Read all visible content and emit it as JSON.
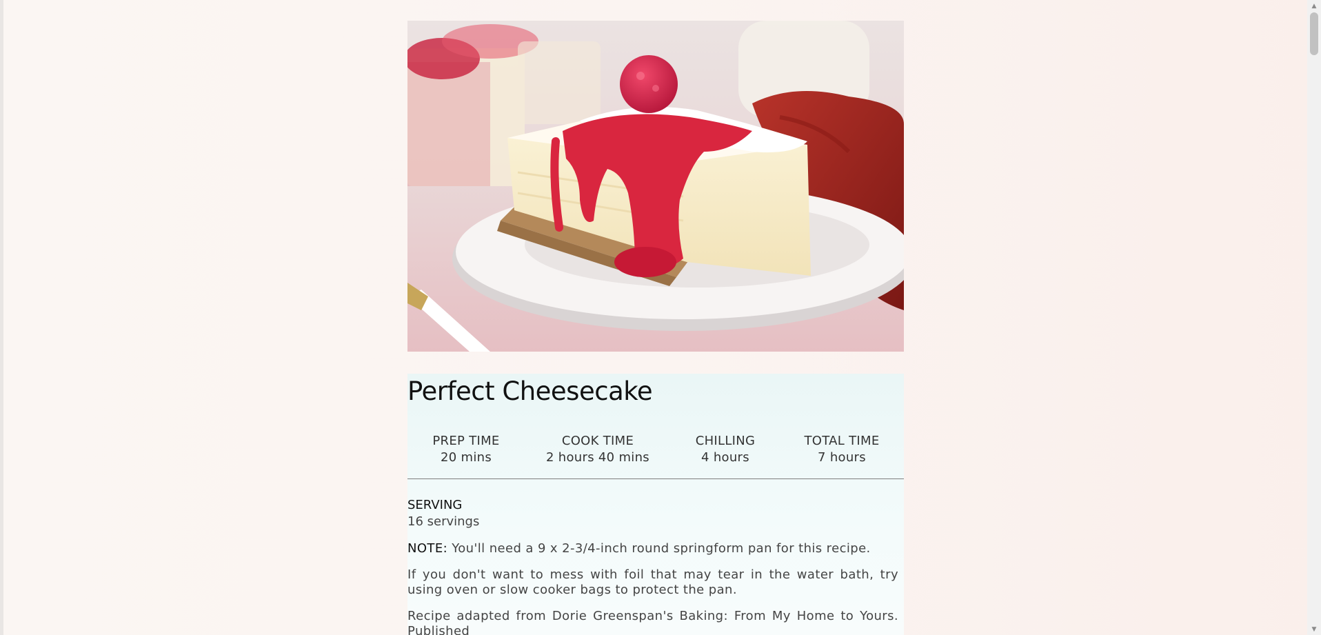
{
  "recipe": {
    "image_alt": "Slice of cheesecake topped with raspberry sauce and a raspberry",
    "title": "Perfect Cheesecake",
    "times": [
      {
        "label": "PREP TIME",
        "value": "20 mins"
      },
      {
        "label": "COOK TIME",
        "value": "2 hours 40 mins"
      },
      {
        "label": "CHILLING",
        "value": "4 hours"
      },
      {
        "label": "TOTAL TIME",
        "value": "7 hours"
      }
    ],
    "serving_label": "SERVING",
    "serving_value": "16 servings",
    "note_label": "NOTE:",
    "note_text": "You'll need a 9 x 2-3/4-inch round springform pan for this recipe.",
    "paragraph_1": "If you don't want to mess with foil that may tear in the water bath, try using oven or slow cooker bags to protect the pan.",
    "paragraph_2": "Recipe adapted from Dorie Greenspan's Baking: From My Home to Yours. Published"
  },
  "scrollbar": {
    "up_icon": "triangle-up-icon",
    "down_icon": "triangle-down-icon"
  },
  "colors": {
    "background": "#fbf5f2",
    "card_background": "#eff9f9",
    "divider": "#7e7e7e",
    "sauce": "#d9263f",
    "napkin": "#a8261f"
  }
}
